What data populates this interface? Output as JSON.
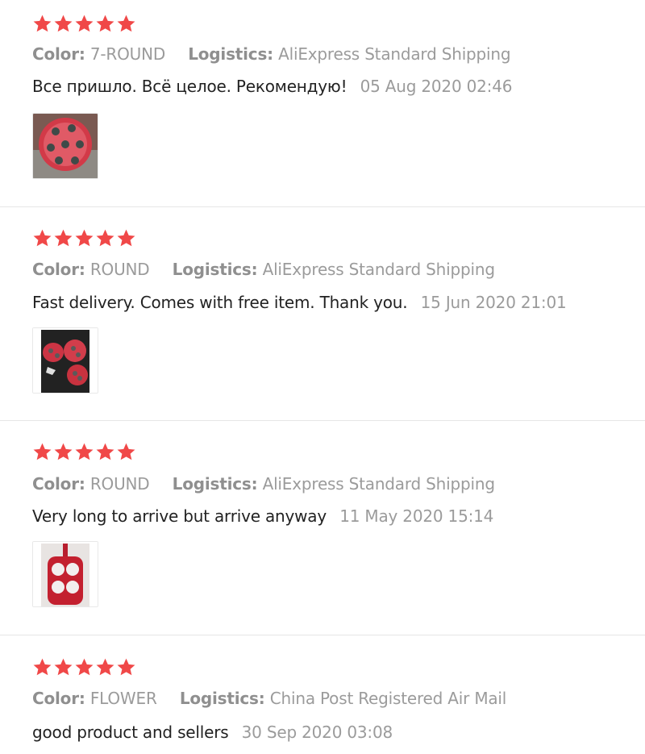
{
  "colors": {
    "star": "#f04848",
    "muted": "#9b9b9b",
    "body": "#222222",
    "divider": "#e6e6e6"
  },
  "labels": {
    "color_key": "Color:",
    "logistics_key": "Logistics:"
  },
  "reviews": [
    {
      "rating": 5,
      "color": "7-ROUND",
      "logistics": "AliExpress Standard Shipping",
      "text": "Все пришло. Всё целое. Рекомендую!",
      "date": "05 Aug 2020 02:46",
      "photo_icon": "red-round-pancake-mold-photo"
    },
    {
      "rating": 5,
      "color": "ROUND",
      "logistics": "AliExpress Standard Shipping",
      "text": "Fast delivery. Comes with free item. Thank you.",
      "date": "15 Jun 2020 21:01",
      "photo_icon": "red-silicone-molds-dark-photo"
    },
    {
      "rating": 5,
      "color": "ROUND",
      "logistics": "AliExpress Standard Shipping",
      "text": "Very long to arrive but arrive anyway",
      "date": "11 May 2020 15:14",
      "photo_icon": "red-four-hole-mold-photo"
    },
    {
      "rating": 5,
      "color": "FLOWER",
      "logistics": "China Post Registered Air Mail",
      "text": "good product and sellers",
      "date": "30 Sep 2020 03:08"
    }
  ]
}
